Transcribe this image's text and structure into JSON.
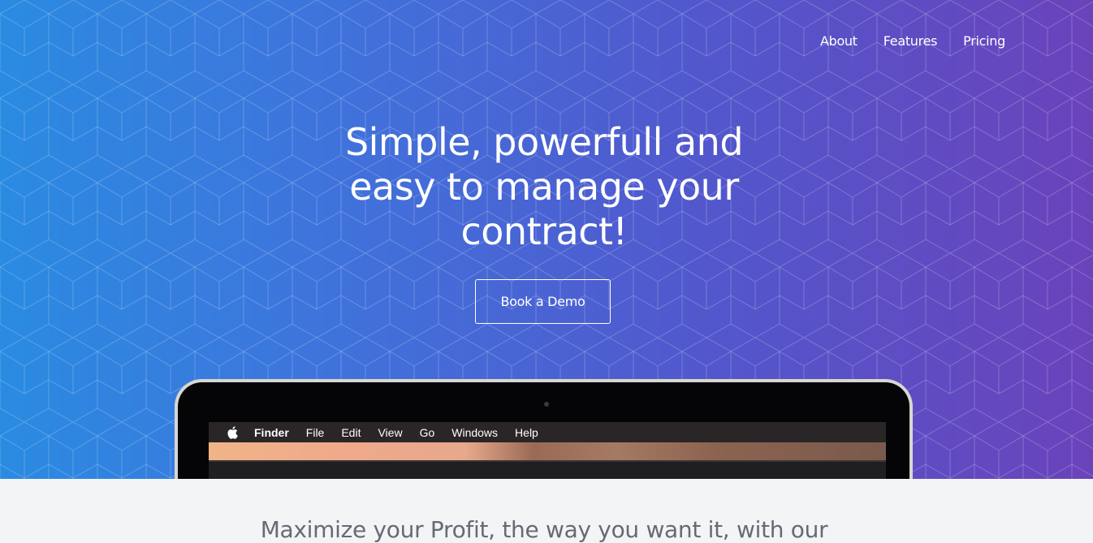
{
  "nav": {
    "items": [
      {
        "label": "About"
      },
      {
        "label": "Features"
      },
      {
        "label": "Pricing"
      }
    ]
  },
  "hero": {
    "headline_lines": [
      "Simple, powerfull and",
      "easy to manage your",
      "contract!"
    ],
    "cta_label": "Book a Demo",
    "gradient_start": "#2a8be1",
    "gradient_end": "#6a43bb"
  },
  "laptop": {
    "menubar": {
      "apple_icon": "apple-logo-icon",
      "items": [
        "Finder",
        "File",
        "Edit",
        "View",
        "Go",
        "Windows",
        "Help"
      ]
    }
  },
  "section": {
    "subtitle": "Maximize your Profit, the way you want it, with our"
  }
}
